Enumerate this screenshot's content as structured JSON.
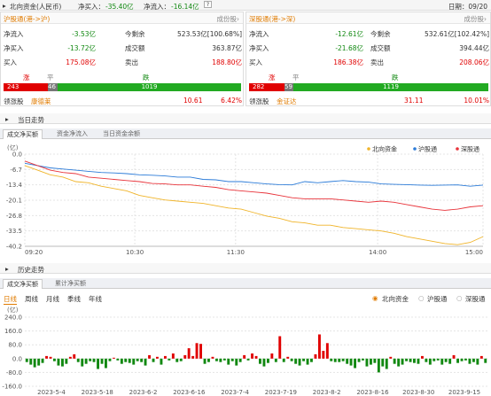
{
  "header": {
    "title": "北向资金(人民币)",
    "net_inflow_label": "净买入：",
    "net_inflow_value": "-35.40亿",
    "net_flow_label": "净流入：",
    "net_flow_value": "-16.14亿",
    "help_icon_text": "?",
    "date": "日期：09/20"
  },
  "colors": {
    "up": "#e00000",
    "down": "#118811",
    "north": "#f0b429",
    "sh": "#2b7bd8",
    "sz": "#e8333a"
  },
  "sh_panel": {
    "title": "沪股通(港->沪)",
    "link": "成份股›",
    "rows": [
      {
        "l1": "净流入",
        "v1": "-3.53亿",
        "l2": "今剩余",
        "v2": "523.53亿[100.68%]"
      },
      {
        "l1": "净买入",
        "v1": "-13.72亿",
        "l2": "成交额",
        "v2": "363.87亿"
      },
      {
        "l1": "买入",
        "v1": "175.08亿",
        "l2": "卖出",
        "v2": "188.80亿"
      }
    ],
    "up_label": "涨",
    "flat_label": "平",
    "down_label": "跌",
    "up_count": "243",
    "flat_count": "46",
    "down_count": "1019",
    "leader_label": "领涨股",
    "leader_name": "康德莱",
    "leader_price": "10.61",
    "leader_pct": "6.42%"
  },
  "sz_panel": {
    "title": "深股通(港->深)",
    "link": "成份股›",
    "rows": [
      {
        "l1": "净流入",
        "v1": "-12.61亿",
        "l2": "今剩余",
        "v2": "532.61亿[102.42%]"
      },
      {
        "l1": "净买入",
        "v1": "-21.68亿",
        "l2": "成交额",
        "v2": "394.44亿"
      },
      {
        "l1": "买入",
        "v1": "186.38亿",
        "l2": "卖出",
        "v2": "208.06亿"
      }
    ],
    "up_label": "涨",
    "flat_label": "平",
    "down_label": "跌",
    "up_count": "282",
    "flat_count": "59",
    "down_count": "1119",
    "leader_label": "领涨股",
    "leader_name": "金证达",
    "leader_price": "31.11",
    "leader_pct": "10.01%"
  },
  "intraday": {
    "section_title": "当日走势",
    "tabs": [
      "成交净买额",
      "资金净流入",
      "当日资金余额"
    ],
    "unit": "(亿)",
    "legend": [
      "北向资金",
      "沪股通",
      "深股通"
    ]
  },
  "history": {
    "section_title": "历史走势",
    "tabs": [
      "成交净买额",
      "累计净买额"
    ],
    "periods": [
      "日线",
      "周线",
      "月线",
      "季线",
      "年线"
    ],
    "radios": [
      "北向资金",
      "沪股通",
      "深股通"
    ],
    "unit": "(亿)"
  },
  "chart_data": [
    {
      "type": "line",
      "x_ticks": [
        "09:20",
        "10:30",
        "11:30",
        "14:00",
        "15:00"
      ],
      "y_ticks": [
        -0.0,
        -6.7,
        -13.4,
        -20.1,
        -26.8,
        -33.5,
        -40.2
      ],
      "ylim": [
        -40.2,
        0
      ],
      "series": [
        {
          "name": "北向资金",
          "values": [
            -5,
            -7,
            -9,
            -10,
            -12,
            -12.5,
            -14,
            -15,
            -16,
            -18,
            -19,
            -20,
            -20.5,
            -21,
            -21.5,
            -22.5,
            -23.5,
            -24,
            -25.5,
            -27,
            -28,
            -29.5,
            -30,
            -31,
            -31,
            -32,
            -32.5,
            -33,
            -33.5,
            -34.5,
            -36,
            -37,
            -38,
            -39,
            -39.5,
            -38.5,
            -36
          ]
        },
        {
          "name": "沪股通",
          "values": [
            -4,
            -5,
            -6,
            -6.5,
            -7,
            -7.5,
            -8,
            -8.2,
            -8.5,
            -9,
            -9.2,
            -9.5,
            -10,
            -10,
            -11,
            -11.2,
            -12,
            -12,
            -12.5,
            -13,
            -13.3,
            -13.4,
            -12,
            -12.5,
            -12,
            -11.5,
            -12,
            -12.2,
            -13,
            -13.2,
            -13.3,
            -13.5,
            -13.6,
            -13.5,
            -13.4,
            -14,
            -13.5
          ]
        },
        {
          "name": "深股通",
          "values": [
            -3,
            -5,
            -7,
            -8,
            -8.5,
            -10,
            -10.5,
            -11,
            -11.5,
            -12,
            -12.8,
            -13,
            -13.4,
            -13.4,
            -14,
            -14.5,
            -15.5,
            -16,
            -16.5,
            -17,
            -18,
            -19,
            -19.5,
            -19.5,
            -19.5,
            -20,
            -20.5,
            -21,
            -20.5,
            -21,
            -22,
            -23,
            -24,
            -24.5,
            -24,
            -23,
            -22.5
          ]
        }
      ]
    },
    {
      "type": "bar",
      "x_ticks": [
        "2023-5-4",
        "2023-5-18",
        "2023-6-2",
        "2023-6-16",
        "2023-7-4",
        "2023-7-19",
        "2023-8-2",
        "2023-8-16",
        "2023-8-30",
        "2023-9-15"
      ],
      "y_ticks": [
        240.0,
        160.0,
        80.0,
        0.0,
        -80.0,
        -160.0
      ],
      "ylim": [
        -160,
        240
      ],
      "values": [
        -20,
        -35,
        -50,
        -40,
        -25,
        15,
        10,
        -15,
        -40,
        -45,
        -30,
        10,
        25,
        -20,
        -45,
        -30,
        -15,
        -20,
        -60,
        -30,
        -55,
        -15,
        5,
        -10,
        -30,
        -20,
        -25,
        -35,
        -15,
        -20,
        -40,
        20,
        -20,
        10,
        -35,
        15,
        -10,
        30,
        -20,
        -15,
        20,
        60,
        15,
        90,
        85,
        -30,
        -20,
        10,
        -15,
        -20,
        -10,
        -35,
        -15,
        -40,
        -20,
        20,
        -10,
        30,
        15,
        -30,
        -45,
        -25,
        30,
        -20,
        130,
        -20,
        10,
        -15,
        -30,
        -40,
        -15,
        -35,
        -20,
        25,
        140,
        45,
        90,
        -15,
        -20,
        -20,
        -15,
        -30,
        -40,
        -55,
        -20,
        -10,
        -45,
        -35,
        -25,
        -80,
        -45,
        -60,
        10,
        -30,
        -45,
        -35,
        -15,
        -20,
        -25,
        -30,
        15,
        -20,
        -35,
        -15,
        -10,
        -35,
        -20,
        -30,
        20,
        -25,
        -15,
        -10,
        -30,
        -20,
        -35,
        15,
        -25
      ]
    }
  ]
}
